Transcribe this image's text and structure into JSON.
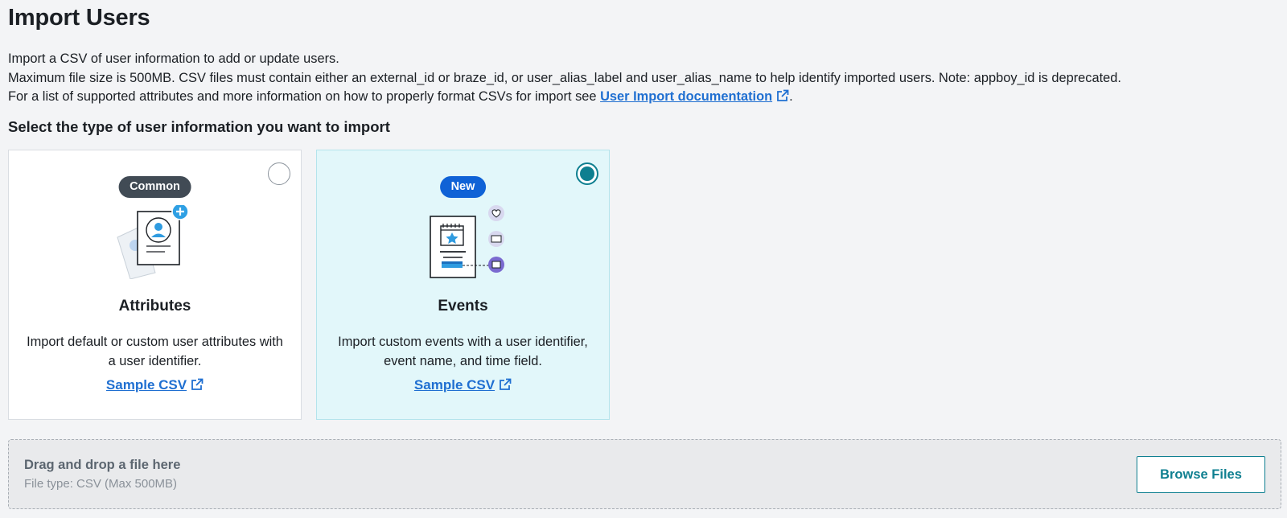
{
  "page": {
    "title": "Import Users",
    "intro_line1": "Import a CSV of user information to add or update users.",
    "intro_line2": "Maximum file size is 500MB. CSV files must contain either an external_id or braze_id, or user_alias_label and user_alias_name to help identify imported users. Note: appboy_id is deprecated.",
    "intro_line3_prefix": "For a list of supported attributes and more information on how to properly format CSVs for import see ",
    "doc_link_label": "User Import documentation",
    "intro_line3_suffix": ".",
    "section_heading": "Select the type of user information you want to import"
  },
  "cards": [
    {
      "badge": "Common",
      "title": "Attributes",
      "description": "Import default or custom user attributes with a user identifier.",
      "link_label": "Sample CSV",
      "selected": false,
      "icon": "contact-card-icon"
    },
    {
      "badge": "New",
      "title": "Events",
      "description": "Import custom events with a user identifier, event name, and time field.",
      "link_label": "Sample CSV",
      "selected": true,
      "icon": "calendar-events-icon"
    }
  ],
  "dropzone": {
    "title": "Drag and drop a file here",
    "subtitle": "File type: CSV (Max 500MB)",
    "button_label": "Browse Files"
  },
  "colors": {
    "link": "#1f6fd1",
    "accent_teal": "#0e7f90",
    "selected_card_bg": "#e2f7fa",
    "badge_common": "#414b55",
    "badge_new": "#0f62d6"
  }
}
